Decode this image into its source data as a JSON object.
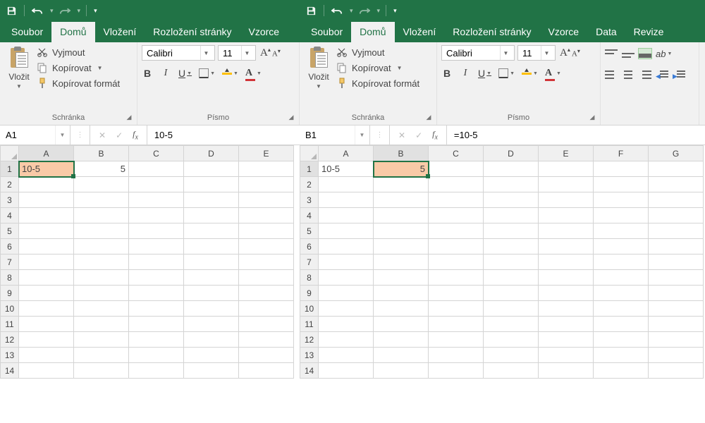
{
  "left": {
    "tabs": [
      "Soubor",
      "Domů",
      "Vložení",
      "Rozložení stránky",
      "Vzorce"
    ],
    "active_tab": 1,
    "clipboard": {
      "paste": "Vložit",
      "cut": "Vyjmout",
      "copy": "Kopírovat",
      "painter": "Kopírovat formát",
      "group": "Schránka"
    },
    "font": {
      "name": "Calibri",
      "size": "11",
      "group": "Písmo"
    },
    "namebox": "A1",
    "formula": "10-5",
    "columns": [
      "A",
      "B",
      "C",
      "D",
      "E"
    ],
    "rows": 14,
    "cells": {
      "A1": "10-5",
      "B1": "5"
    },
    "selected": "A1",
    "highlighted": "A1"
  },
  "right": {
    "tabs": [
      "Soubor",
      "Domů",
      "Vložení",
      "Rozložení stránky",
      "Vzorce",
      "Data",
      "Revize"
    ],
    "active_tab": 1,
    "clipboard": {
      "paste": "Vložit",
      "cut": "Vyjmout",
      "copy": "Kopírovat",
      "painter": "Kopírovat formát",
      "group": "Schránka"
    },
    "font": {
      "name": "Calibri",
      "size": "11",
      "group": "Písmo"
    },
    "namebox": "B1",
    "formula": "=10-5",
    "columns": [
      "A",
      "B",
      "C",
      "D",
      "E",
      "F",
      "G"
    ],
    "rows": 14,
    "cells": {
      "A1": "10-5",
      "B1": "5"
    },
    "selected": "B1",
    "highlighted": "B1"
  }
}
